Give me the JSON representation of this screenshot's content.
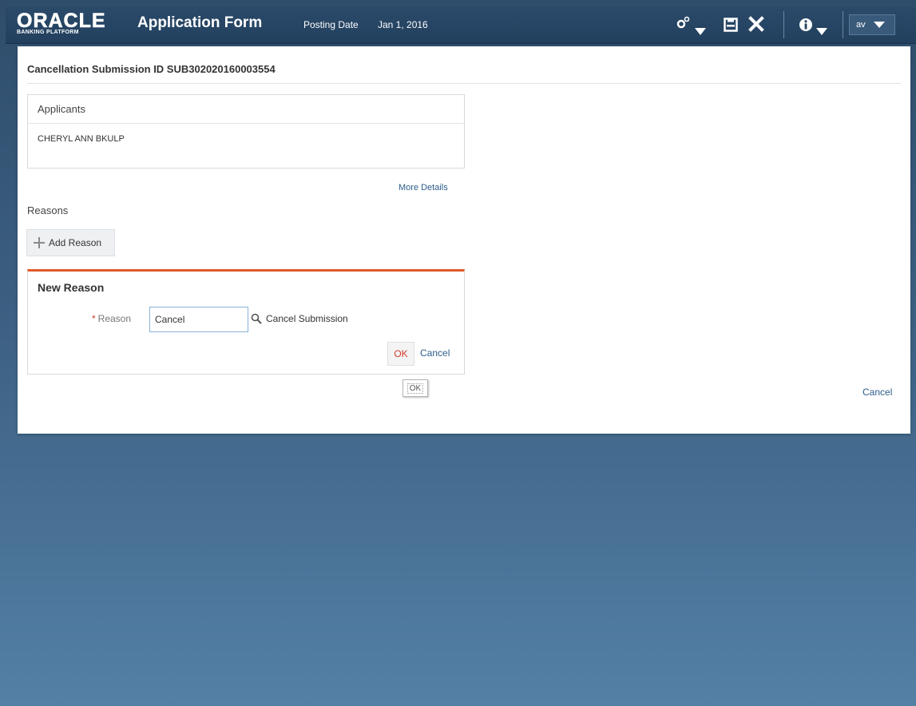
{
  "header": {
    "logo_main": "ORACLE",
    "logo_sub": "BANKING PLATFORM",
    "app_title": "Application Form",
    "posting_date_label": "Posting Date",
    "posting_date_value": "Jan 1, 2016",
    "user_initials": "av",
    "icons": [
      "settings-icon",
      "save-icon",
      "close-icon",
      "info-icon"
    ]
  },
  "panel": {
    "title": "Cancellation Submission ID SUB302020160003554",
    "applicants": {
      "heading": "Applicants",
      "names": [
        "CHERYL ANN BKULP"
      ]
    },
    "more_details": "More Details",
    "reasons_label": "Reasons",
    "add_reason_label": "Add Reason",
    "new_reason": {
      "title": "New Reason",
      "reason_label": "Reason",
      "required_marker": "*",
      "reason_value": "Cancel",
      "reason_description": "Cancel Submission",
      "ok_label": "OK",
      "cancel_label": "Cancel"
    },
    "tooltip_text": "OK",
    "footer_cancel": "Cancel"
  },
  "colors": {
    "accent_orange": "#e0592a",
    "link_blue": "#2c5d8c",
    "header_bg": "#22405e",
    "ok_red": "#d23b2a"
  }
}
